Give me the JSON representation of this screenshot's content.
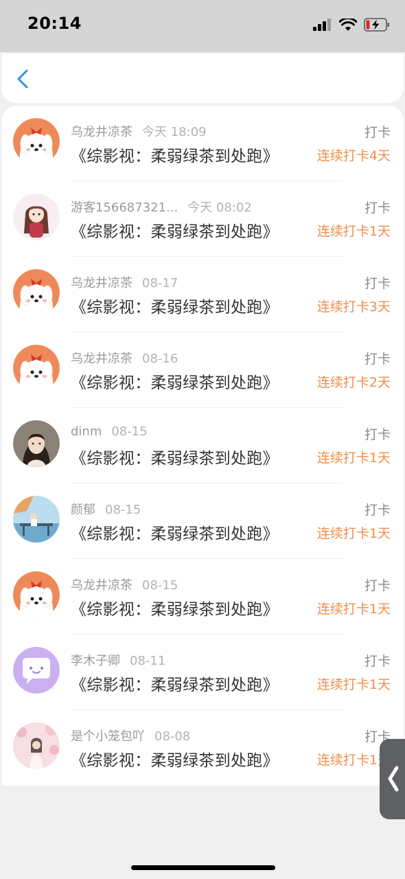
{
  "status_bar": {
    "time": "20:14",
    "icons": [
      "signal-icon",
      "wifi-icon",
      "battery-charging-icon"
    ]
  },
  "nav": {
    "back_icon": "chevron-left-icon"
  },
  "colors": {
    "accent": "#ef8e4a",
    "back": "#2f8fea",
    "meta": "#9b9b9b"
  },
  "checkins": [
    {
      "user": "乌龙井凉茶",
      "time": "今天 18:09",
      "action": "打卡",
      "book": "《综影视：柔弱绿茶到处跑》",
      "streak": "连续打卡4天",
      "avatar": "puppy-avatar"
    },
    {
      "user": "游客156687321...",
      "time": "今天 08:02",
      "action": "打卡",
      "book": "《综影视：柔弱绿茶到处跑》",
      "streak": "连续打卡1天",
      "avatar": "anime-girl-avatar"
    },
    {
      "user": "乌龙井凉茶",
      "time": "08-17",
      "action": "打卡",
      "book": "《综影视：柔弱绿茶到处跑》",
      "streak": "连续打卡3天",
      "avatar": "puppy-avatar"
    },
    {
      "user": "乌龙井凉茶",
      "time": "08-16",
      "action": "打卡",
      "book": "《综影视：柔弱绿茶到处跑》",
      "streak": "连续打卡2天",
      "avatar": "puppy-avatar"
    },
    {
      "user": "dinm",
      "time": "08-15",
      "action": "打卡",
      "book": "《综影视：柔弱绿茶到处跑》",
      "streak": "连续打卡1天",
      "avatar": "photo-girl-avatar"
    },
    {
      "user": "颜郁",
      "time": "08-15",
      "action": "打卡",
      "book": "《综影视：柔弱绿茶到处跑》",
      "streak": "连续打卡1天",
      "avatar": "scenery-avatar"
    },
    {
      "user": "乌龙井凉茶",
      "time": "08-15",
      "action": "打卡",
      "book": "《综影视：柔弱绿茶到处跑》",
      "streak": "连续打卡1天",
      "avatar": "puppy-avatar"
    },
    {
      "user": "李木子卿",
      "time": "08-11",
      "action": "打卡",
      "book": "《综影视：柔弱绿茶到处跑》",
      "streak": "连续打卡1天",
      "avatar": "chat-bubble-avatar"
    },
    {
      "user": "是个小笼包吖",
      "time": "08-08",
      "action": "打卡",
      "book": "《综影视：柔弱绿茶到处跑》",
      "streak": "连续打卡1天",
      "avatar": "pink-girl-avatar"
    }
  ]
}
